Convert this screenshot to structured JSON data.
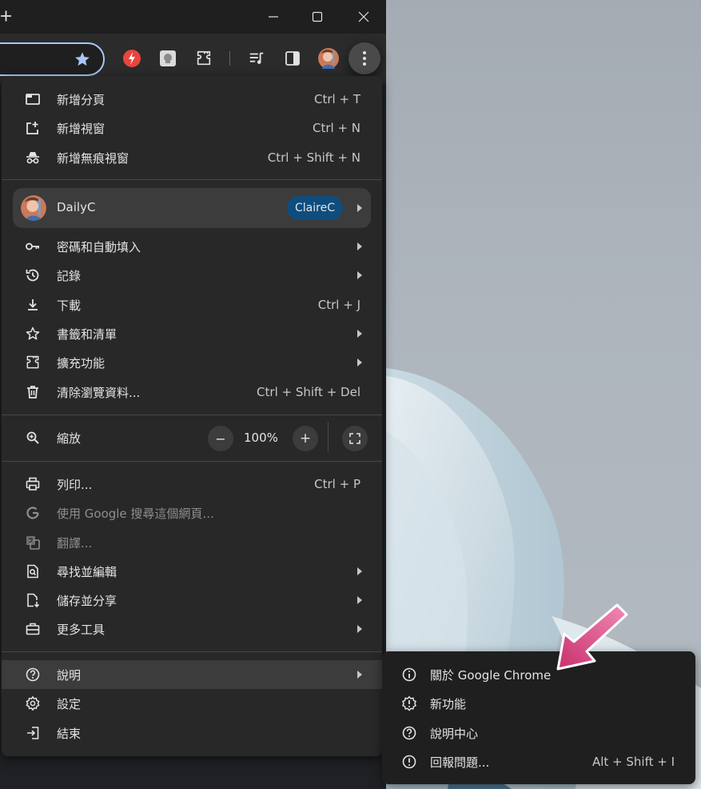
{
  "colors": {
    "menu_bg": "#282828",
    "submenu_bg": "#1f1f1f",
    "highlight": "#3c3c3c",
    "accent_focus": "#a8c7fa",
    "profile_pill": "#0e4d7e",
    "annotation_arrow": "#d8457f"
  },
  "titlebar": {
    "new_tab_icon": "plus-icon",
    "window_controls": [
      "minimize-icon",
      "maximize-icon",
      "close-icon"
    ]
  },
  "toolbar": {
    "icons": [
      "star-icon",
      "extension-red-icon",
      "extension-white-icon",
      "puzzle-icon",
      "media-queue-icon",
      "side-panel-icon",
      "avatar",
      "kebab-menu-icon"
    ]
  },
  "menu": {
    "new_tab": {
      "label": "新增分頁",
      "shortcut": "Ctrl + T",
      "icon": "new-tab-icon"
    },
    "new_window": {
      "label": "新增視窗",
      "shortcut": "Ctrl + N",
      "icon": "new-window-icon"
    },
    "new_incognito": {
      "label": "新增無痕視窗",
      "shortcut": "Ctrl + Shift + N",
      "icon": "incognito-icon"
    },
    "profile": {
      "name": "DailyC",
      "account": "ClaireC"
    },
    "passwords": {
      "label": "密碼和自動填入",
      "icon": "key-icon"
    },
    "history": {
      "label": "記錄",
      "icon": "history-icon"
    },
    "downloads": {
      "label": "下載",
      "shortcut": "Ctrl + J",
      "icon": "download-icon"
    },
    "bookmarks": {
      "label": "書籤和清單",
      "icon": "star-outline-icon"
    },
    "extensions": {
      "label": "擴充功能",
      "icon": "puzzle-icon"
    },
    "clear_data": {
      "label": "清除瀏覽資料...",
      "shortcut": "Ctrl + Shift + Del",
      "icon": "trash-icon"
    },
    "zoom": {
      "label": "縮放",
      "value": "100%",
      "minus": "−",
      "plus": "+"
    },
    "print": {
      "label": "列印...",
      "shortcut": "Ctrl + P",
      "icon": "printer-icon"
    },
    "search_google": {
      "label": "使用 Google 搜尋這個網頁...",
      "icon": "google-g-icon"
    },
    "translate": {
      "label": "翻譯...",
      "icon": "translate-icon"
    },
    "find_edit": {
      "label": "尋找並編輯",
      "icon": "find-page-icon"
    },
    "save_share": {
      "label": "儲存並分享",
      "icon": "save-page-icon"
    },
    "more_tools": {
      "label": "更多工具",
      "icon": "toolbox-icon"
    },
    "help": {
      "label": "說明",
      "icon": "help-icon"
    },
    "settings": {
      "label": "設定",
      "icon": "gear-icon"
    },
    "exit": {
      "label": "結束",
      "icon": "exit-icon"
    }
  },
  "submenu": {
    "about": {
      "label": "關於 Google Chrome",
      "icon": "info-icon"
    },
    "whats_new": {
      "label": "新功能",
      "icon": "new-badge-icon"
    },
    "help_center": {
      "label": "說明中心",
      "icon": "help-icon"
    },
    "report_issue": {
      "label": "回報問題...",
      "shortcut": "Alt + Shift + I",
      "icon": "report-icon"
    }
  }
}
